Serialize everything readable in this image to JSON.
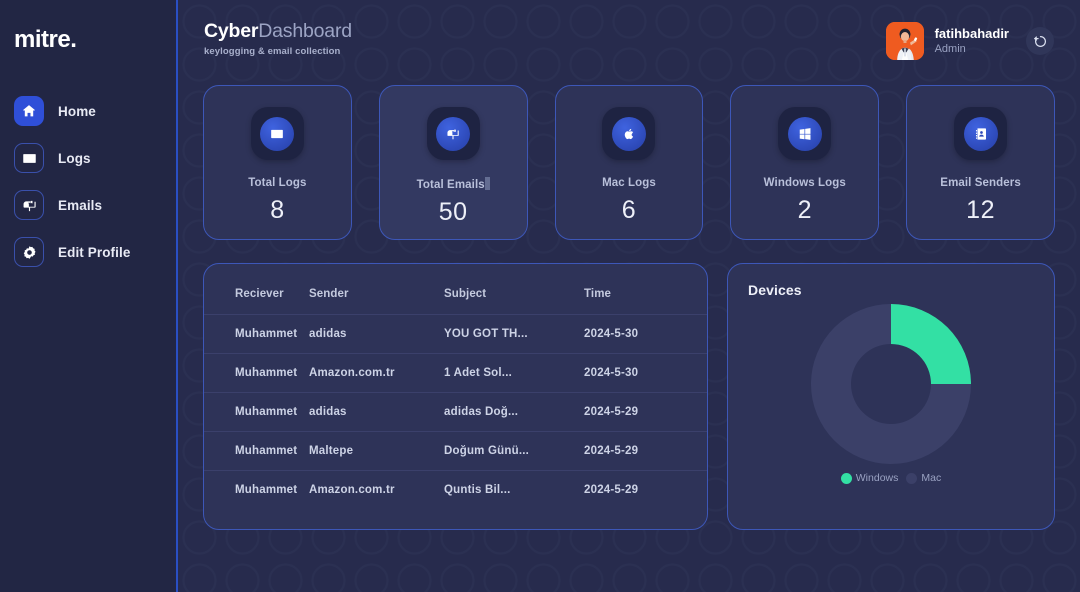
{
  "theme": {
    "sidebar_bg": "#222644",
    "main_bg": "#272b4d",
    "card_bg": "#2e3358",
    "card_border": "#3d57b8",
    "accent_blue": "#2f4fd8",
    "accent_green": "#33e0a4",
    "muted_slate": "#3b4068",
    "avatar_bg": "#ef5b20"
  },
  "sidebar": {
    "logo": "mitre.",
    "items": [
      {
        "label": "Home",
        "icon": "home-icon",
        "active": true
      },
      {
        "label": "Logs",
        "icon": "keyboard-icon",
        "active": false
      },
      {
        "label": "Emails",
        "icon": "mailbox-icon",
        "active": false
      },
      {
        "label": "Edit Profile",
        "icon": "gear-icon",
        "active": false
      }
    ]
  },
  "header": {
    "title_strong": "Cyber",
    "title_soft": "Dashboard",
    "subtitle": "keylogging & email collection",
    "user": {
      "name": "fatihbahadir",
      "role": "Admin",
      "avatar": "user-avatar"
    },
    "logout_icon": "logout-icon"
  },
  "stats": [
    {
      "label": "Total Logs",
      "value": "8",
      "icon": "keyboard-icon",
      "highlighted": false,
      "has_caret": false
    },
    {
      "label": "Total Emails",
      "value": "50",
      "icon": "mailbox-icon",
      "highlighted": true,
      "has_caret": true
    },
    {
      "label": "Mac Logs",
      "value": "6",
      "icon": "apple-icon",
      "highlighted": false,
      "has_caret": false
    },
    {
      "label": "Windows Logs",
      "value": "2",
      "icon": "windows-icon",
      "highlighted": false,
      "has_caret": false
    },
    {
      "label": "Email Senders",
      "value": "12",
      "icon": "contacts-icon",
      "highlighted": false,
      "has_caret": false
    }
  ],
  "table": {
    "columns": [
      "Reciever",
      "Sender",
      "Subject",
      "Time"
    ],
    "rows": [
      [
        "Muhammet",
        "adidas",
        "YOU GOT TH...",
        "2024-5-30"
      ],
      [
        "Muhammet",
        "Amazon.com.tr",
        "1 Adet Sol...",
        "2024-5-30"
      ],
      [
        "Muhammet",
        "adidas",
        "adidas Doğ...",
        "2024-5-29"
      ],
      [
        "Muhammet",
        "Maltepe",
        "Doğum Günü...",
        "2024-5-29"
      ],
      [
        "Muhammet",
        "Amazon.com.tr",
        "Quntis Bil...",
        "2024-5-29"
      ]
    ]
  },
  "chart_data": {
    "type": "pie",
    "title": "Devices",
    "subtype": "donut",
    "labels": [
      "Windows",
      "Mac"
    ],
    "values": [
      25,
      75
    ],
    "colors": [
      "#33e0a4",
      "#3b4068"
    ],
    "legend_position": "bottom",
    "grid": false,
    "xlabel": "",
    "ylabel": "",
    "notes": "Windows occupies the first quarter (0-90 degrees clockwise from top); Mac fills remaining 270 degrees"
  }
}
